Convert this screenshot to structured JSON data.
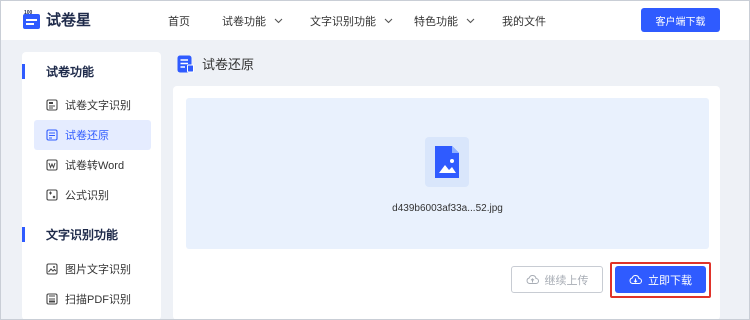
{
  "header": {
    "logo_text": "试卷星",
    "nav": [
      {
        "label": "首页",
        "has_dropdown": false
      },
      {
        "label": "试卷功能",
        "has_dropdown": true
      },
      {
        "label": "文字识别功能",
        "has_dropdown": true
      },
      {
        "label": "特色功能",
        "has_dropdown": true
      },
      {
        "label": "我的文件",
        "has_dropdown": false
      }
    ],
    "client_download": "客户端下载"
  },
  "sidebar": {
    "groups": [
      {
        "title": "试卷功能",
        "items": [
          {
            "label": "试卷文字识别",
            "icon": "doc-text-icon"
          },
          {
            "label": "试卷还原",
            "icon": "doc-restore-icon",
            "active": true
          },
          {
            "label": "试卷转Word",
            "icon": "doc-word-icon"
          },
          {
            "label": "公式识别",
            "icon": "formula-icon"
          }
        ]
      },
      {
        "title": "文字识别功能",
        "items": [
          {
            "label": "图片文字识别",
            "icon": "image-text-icon"
          },
          {
            "label": "扫描PDF识别",
            "icon": "scan-pdf-icon"
          }
        ]
      }
    ]
  },
  "main": {
    "title": "试卷还原",
    "file_name": "d439b6003af33a...52.jpg",
    "continue_upload": "继续上传",
    "download_now": "立即下载"
  },
  "colors": {
    "accent": "#2f5bff",
    "highlight_border": "#e0332a",
    "dropzone_bg": "#e9f1fd"
  }
}
